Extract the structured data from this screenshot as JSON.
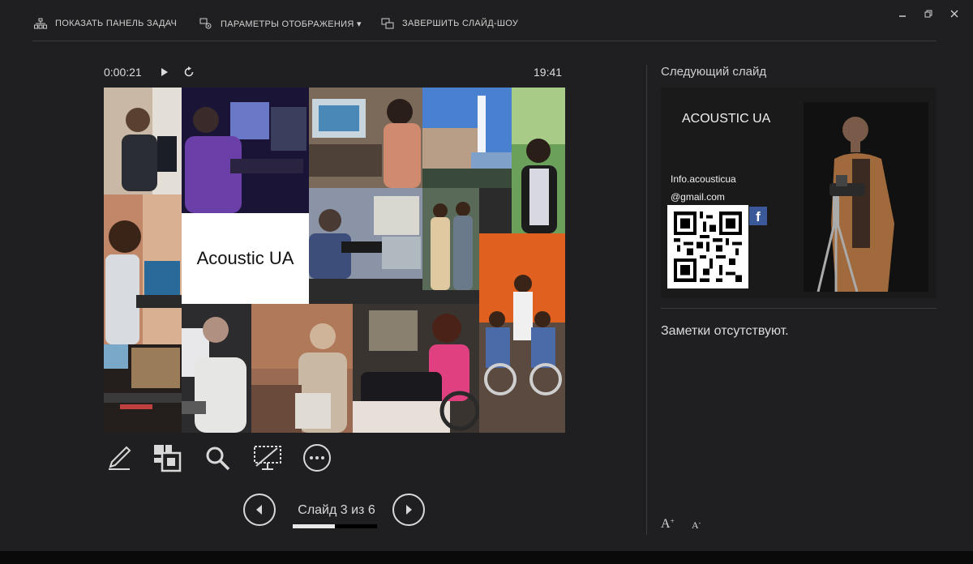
{
  "toolbar": {
    "show_taskbar": "ПОКАЗАТЬ ПАНЕЛЬ ЗАДАЧ",
    "display_settings": "ПАРАМЕТРЫ ОТОБРАЖЕНИЯ ▾",
    "end_slideshow": "ЗАВЕРШИТЬ СЛАЙД-ШОУ"
  },
  "presenter": {
    "elapsed_time": "0:00:21",
    "clock": "19:41",
    "current_slide_caption": "Acoustic UA",
    "slide_counter": "Слайд 3 из 6",
    "progress_fraction": 0.5
  },
  "next_slide": {
    "heading": "Следующий слайд",
    "title": "ACOUSTIC UA",
    "email_line1": "Info.acousticua",
    "email_line2": "@gmail.com",
    "fb_letter": "f"
  },
  "notes": {
    "text": "Заметки отсутствуют."
  },
  "font_controls": {
    "increase": "A",
    "decrease": "A"
  },
  "icons": {
    "pen": "pen-icon",
    "all_slides": "all-slides-icon",
    "zoom": "magnifier-icon",
    "black_screen": "screen-icon",
    "more": "more-icon"
  }
}
